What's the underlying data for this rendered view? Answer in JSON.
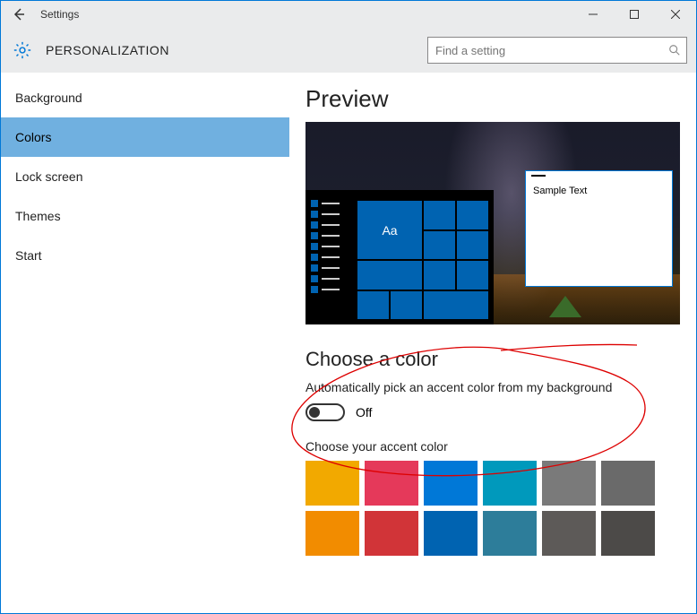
{
  "titlebar": {
    "title": "Settings"
  },
  "header": {
    "title": "PERSONALIZATION",
    "search_placeholder": "Find a setting"
  },
  "sidebar": {
    "items": [
      {
        "label": "Background",
        "active": false
      },
      {
        "label": "Colors",
        "active": true
      },
      {
        "label": "Lock screen",
        "active": false
      },
      {
        "label": "Themes",
        "active": false
      },
      {
        "label": "Start",
        "active": false
      }
    ]
  },
  "content": {
    "preview_heading": "Preview",
    "sample_text": "Sample Text",
    "tile_text": "Aa",
    "choose_color_heading": "Choose a color",
    "auto_pick_label": "Automatically pick an accent color from my background",
    "toggle_state": "Off",
    "accent_label": "Choose your accent color",
    "accent_colors": [
      "#f2a900",
      "#e5395a",
      "#0078d7",
      "#0099bc",
      "#7a7a7a",
      "#6a6a6a",
      "#f28c00",
      "#d13438",
      "#0063b1",
      "#2d7d9a",
      "#5d5a58",
      "#4c4a48"
    ],
    "accent_default": "#0078d7"
  }
}
